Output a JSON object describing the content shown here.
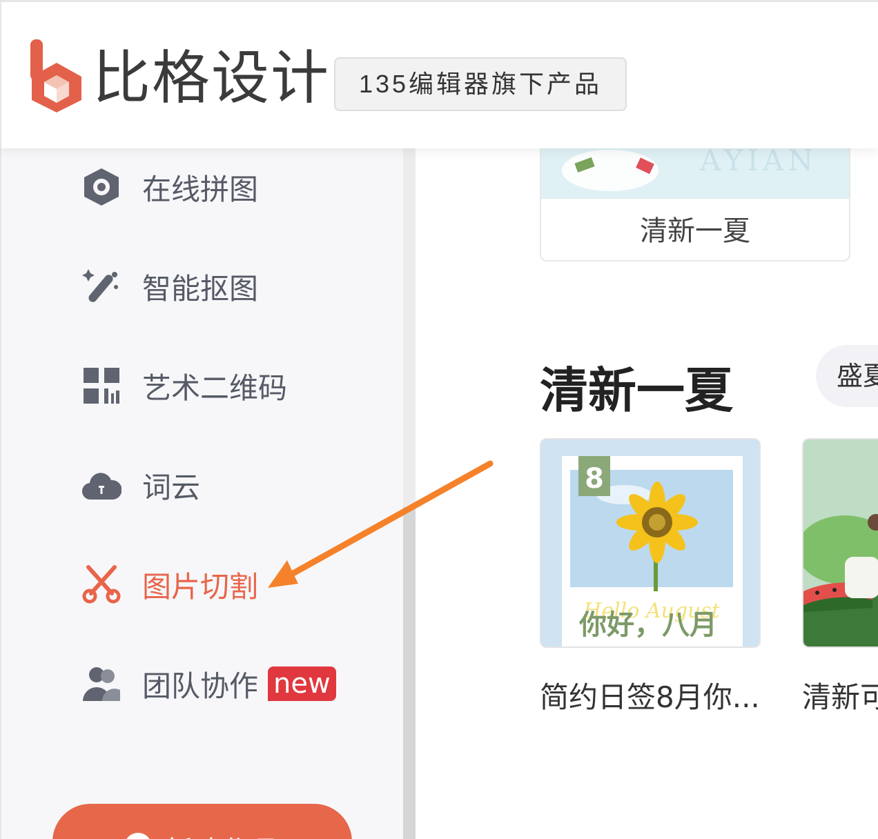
{
  "header": {
    "brand_name": "比格设计",
    "brand_badge": "135编辑器旗下产品"
  },
  "sidebar": {
    "items": [
      {
        "label": "在线拼图",
        "icon": "hexagon-eye-icon"
      },
      {
        "label": "智能抠图",
        "icon": "magic-wand-icon"
      },
      {
        "label": "艺术二维码",
        "icon": "qr-code-icon"
      },
      {
        "label": "词云",
        "icon": "cloud-icon"
      },
      {
        "label": "图片切割",
        "icon": "scissors-icon",
        "active": true
      },
      {
        "label": "团队协作",
        "icon": "team-icon",
        "badge": "new"
      }
    ],
    "create_button": "新建作品"
  },
  "main": {
    "top_card_caption": "清新一夏",
    "section_title": "清新一夏",
    "chip_label": "盛夏",
    "templates": [
      {
        "title": "简约日签8月你...",
        "date_number": "8",
        "thumb_text": "你好，八月",
        "thumb_script": "Hello August"
      },
      {
        "title": "清新可"
      }
    ]
  },
  "colors": {
    "accent": "#e8654a",
    "badge_red": "#e0383e",
    "annotation_arrow": "#f5822a",
    "nav_text": "#555a66"
  }
}
